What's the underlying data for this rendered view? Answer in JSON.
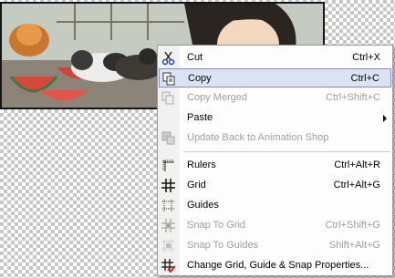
{
  "canvas": {
    "description_icon": "image-canvas"
  },
  "menu": {
    "items": [
      {
        "label": "Cut",
        "shortcut": "Ctrl+X",
        "icon": "scissors-icon",
        "disabled": false,
        "highlighted": false,
        "submenu": false
      },
      {
        "label": "Copy",
        "shortcut": "Ctrl+C",
        "icon": "copy-icon",
        "disabled": false,
        "highlighted": true,
        "submenu": false
      },
      {
        "label": "Copy Merged",
        "shortcut": "Ctrl+Shift+C",
        "icon": "copy-merged-icon",
        "disabled": true,
        "highlighted": false,
        "submenu": false
      },
      {
        "label": "Paste",
        "shortcut": "",
        "icon": "",
        "disabled": false,
        "highlighted": false,
        "submenu": true
      },
      {
        "label": "Update Back to Animation Shop",
        "shortcut": "",
        "icon": "update-back-icon",
        "disabled": true,
        "highlighted": false,
        "submenu": false
      },
      {
        "label": "Rulers",
        "shortcut": "Ctrl+Alt+R",
        "icon": "rulers-icon",
        "disabled": false,
        "highlighted": false,
        "submenu": false
      },
      {
        "label": "Grid",
        "shortcut": "Ctrl+Alt+G",
        "icon": "grid-icon",
        "disabled": false,
        "highlighted": false,
        "submenu": false
      },
      {
        "label": "Guides",
        "shortcut": "",
        "icon": "guides-icon",
        "disabled": false,
        "highlighted": false,
        "submenu": false
      },
      {
        "label": "Snap To Grid",
        "shortcut": "Ctrl+Shift+G",
        "icon": "snap-to-grid-icon",
        "disabled": true,
        "highlighted": false,
        "submenu": false
      },
      {
        "label": "Snap To Guides",
        "shortcut": "Shift+Alt+G",
        "icon": "snap-to-guides-icon",
        "disabled": true,
        "highlighted": false,
        "submenu": false
      },
      {
        "label": "Change Grid, Guide & Snap Properties...",
        "shortcut": "",
        "icon": "grid-properties-icon",
        "disabled": false,
        "highlighted": false,
        "submenu": false
      }
    ]
  }
}
